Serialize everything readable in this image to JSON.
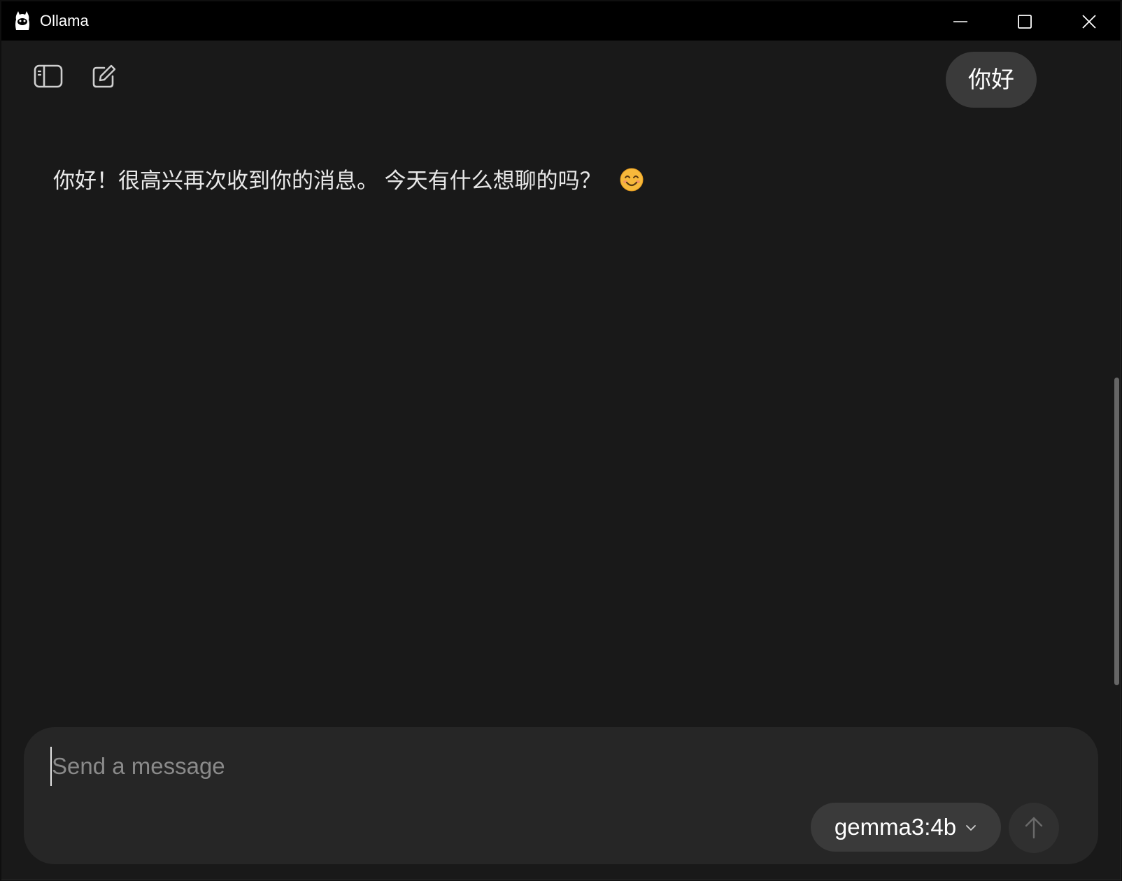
{
  "window": {
    "title": "Ollama"
  },
  "chat": {
    "user_message": "你好",
    "assistant_message": "你好！很高兴再次收到你的消息。 今天有什么想聊的吗？",
    "assistant_emoji": "😊"
  },
  "composer": {
    "placeholder": "Send a message",
    "value": "",
    "model": "gemma3:4b"
  },
  "icons": {
    "app": "llama-icon",
    "sidebar_toggle": "sidebar-toggle-icon",
    "new_chat": "new-chat-icon",
    "model_dropdown": "chevron-down-icon",
    "send": "arrow-up-icon",
    "minimize": "minimize-icon",
    "maximize": "maximize-icon",
    "close": "close-icon"
  },
  "colors": {
    "background": "#191919",
    "titlebar": "#000000",
    "bubble": "#3a3a3a",
    "composer": "#262626",
    "text": "#e8e8e8",
    "placeholder": "#8a8a8a"
  }
}
